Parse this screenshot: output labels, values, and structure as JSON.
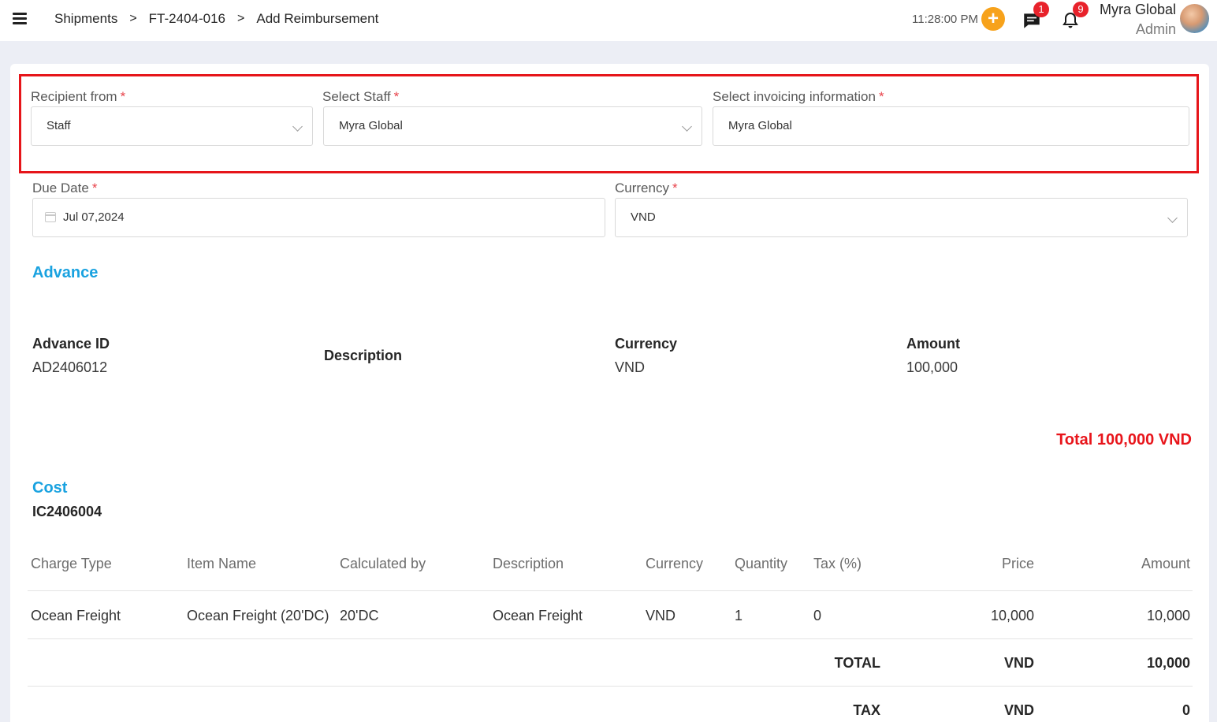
{
  "header": {
    "breadcrumb": [
      "Shipments",
      "FT-2404-016",
      "Add Reimbursement"
    ],
    "separator": ">",
    "clock": "11:28:00 PM",
    "add_symbol": "+",
    "messages_badge": "1",
    "notifications_badge": "9",
    "user_name": "Myra Global",
    "user_role": "Admin"
  },
  "form": {
    "recipient_from": {
      "label": "Recipient from",
      "value": "Staff"
    },
    "select_staff": {
      "label": "Select Staff",
      "value": "Myra Global"
    },
    "invoicing_info": {
      "label": "Select invoicing information",
      "value": "Myra Global"
    },
    "due_date": {
      "label": "Due Date",
      "value": "Jul 07,2024"
    },
    "currency": {
      "label": "Currency",
      "value": "VND"
    },
    "required_mark": "*"
  },
  "advance": {
    "title": "Advance",
    "headers": {
      "id": "Advance ID",
      "description": "Description",
      "currency": "Currency",
      "amount": "Amount"
    },
    "row": {
      "id": "AD2406012",
      "currency": "VND",
      "amount": "100,000"
    },
    "total_label": "Total",
    "total_value": "100,000 VND"
  },
  "cost": {
    "title": "Cost",
    "id": "IC2406004",
    "columns": [
      "Charge Type",
      "Item Name",
      "Calculated by",
      "Description",
      "Currency",
      "Quantity",
      "Tax (%)",
      "Price",
      "Amount"
    ],
    "rows": [
      {
        "charge_type": "Ocean Freight",
        "item_name": "Ocean Freight (20'DC)",
        "calculated_by": "20'DC",
        "description": "Ocean Freight",
        "currency": "VND",
        "quantity": "1",
        "tax": "0",
        "price": "10,000",
        "amount": "10,000"
      }
    ],
    "total_label": "TOTAL",
    "total_currency": "VND",
    "total_value": "10,000",
    "tax_label": "TAX",
    "tax_currency": "VND",
    "tax_value": "0"
  },
  "colors": {
    "accent_blue": "#19a2e0",
    "total_red": "#e8151b",
    "highlight_border": "#e6151a",
    "add_button": "#f7a21b"
  },
  "icons": [
    "menu-icon",
    "plus-icon",
    "message-icon",
    "bell-icon",
    "calendar-icon",
    "chevron-down-icon"
  ]
}
